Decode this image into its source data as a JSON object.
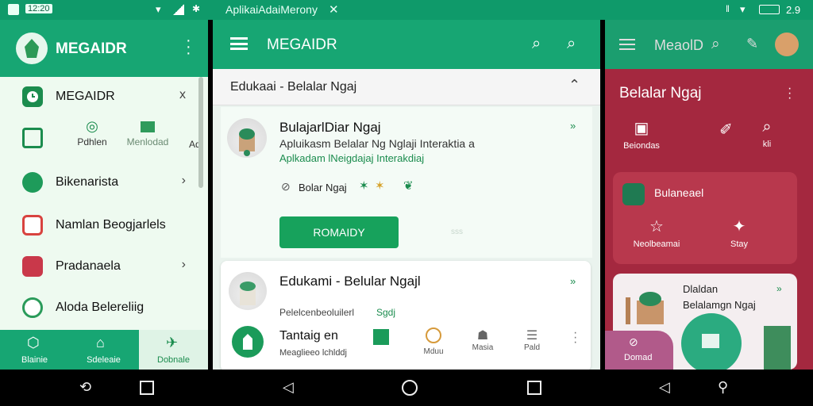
{
  "status_bar": {
    "time_left": "12:20",
    "app_title": "AplikaiAdaiMerony",
    "time_right": "2.9"
  },
  "panel1": {
    "app_name": "MEGAIDR",
    "menu": [
      {
        "label": "MEGAIDR",
        "chevron": "x",
        "color": "#1b9b5a"
      },
      {
        "label": "Bikenarista",
        "chevron": "›",
        "color": "#1e9b5a"
      },
      {
        "label": "Namlan Beogjarlels",
        "chevron": "",
        "color": "#d8433f"
      },
      {
        "label": "Pradanaela",
        "chevron": "›",
        "color": "#c9384a"
      },
      {
        "label": "Aloda Belereliig",
        "chevron": "",
        "color": "#2a9b5a"
      }
    ],
    "sub_items": [
      {
        "label": "Pdhlen"
      },
      {
        "label": "Menlodad"
      },
      {
        "label": "Ad"
      }
    ],
    "bottom_tabs": [
      {
        "label": "Blainie"
      },
      {
        "label": "Sdeleaie"
      },
      {
        "label": "Dobnale"
      }
    ]
  },
  "panel2": {
    "app_name": "MEGAIDR",
    "section_label": "Edukaai - Belalar Ngaj",
    "card1": {
      "title": "BulajarlDiar Ngaj",
      "desc": "Apluikasm Belalar Ng Nglaji Interaktia a",
      "desc_green": "Aplkadam lNeigdajaj Interakdiaj",
      "tag": "Bolar Ngaj",
      "button": "ROMAIDY",
      "side_text": "sss"
    },
    "card2": {
      "title": "Edukami - Belular Ngajl",
      "sub": "Pelelcenbeoluilerl",
      "sub_green": "Sgdj",
      "row_title": "Tantaig en",
      "row_sub": "Meaglieeo lchlddj",
      "tabs": [
        {
          "label": "Mduu"
        },
        {
          "label": "Masia"
        },
        {
          "label": "Pald"
        }
      ]
    }
  },
  "panel3": {
    "app_name": "MeaolD",
    "title": "Belalar Ngaj",
    "items": [
      {
        "label": "Beiondas"
      },
      {
        "label": ""
      },
      {
        "label": "kli"
      }
    ],
    "card_title": "Bulaneael",
    "card_items": [
      {
        "label": "Neolbeamai"
      },
      {
        "label": "Stay"
      }
    ],
    "promo_title_1": "Dlaldan",
    "promo_title_2": "Belalamgn Ngaj",
    "bottom_label": "Domad"
  },
  "colors": {
    "primary": "#17a673",
    "accent": "#a4283f",
    "background": "#eaf8ec"
  }
}
